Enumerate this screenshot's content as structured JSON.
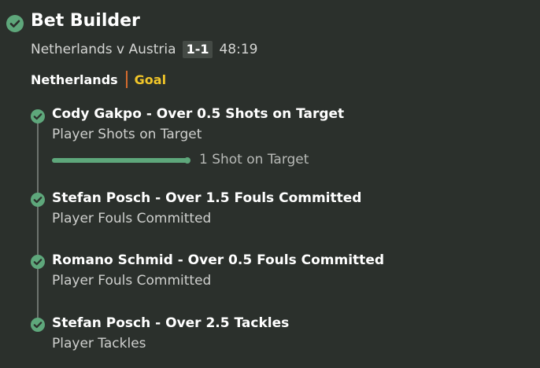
{
  "header": {
    "title": "Bet Builder",
    "status_icon": "check-circle-icon",
    "match": "Netherlands v Austria",
    "score": "1-1",
    "clock": "48:19"
  },
  "event": {
    "team": "Netherlands",
    "type": "Goal",
    "divider_color": "#d36a2e",
    "type_color": "#f2c629"
  },
  "colors": {
    "background": "#2b302c",
    "success": "#5ea77b",
    "timeline": "#6d736e"
  },
  "legs": [
    {
      "title": "Cody Gakpo - Over 0.5 Shots on Target",
      "market": "Player Shots on Target",
      "status_icon": "check-circle-icon",
      "progress": {
        "fraction": 1.0,
        "label": "1 Shot on Target"
      }
    },
    {
      "title": "Stefan Posch - Over 1.5 Fouls Committed",
      "market": "Player Fouls Committed",
      "status_icon": "check-circle-icon"
    },
    {
      "title": "Romano Schmid - Over 0.5 Fouls Committed",
      "market": "Player Fouls Committed",
      "status_icon": "check-circle-icon"
    },
    {
      "title": "Stefan Posch - Over 2.5 Tackles",
      "market": "Player Tackles",
      "status_icon": "check-circle-icon"
    }
  ]
}
